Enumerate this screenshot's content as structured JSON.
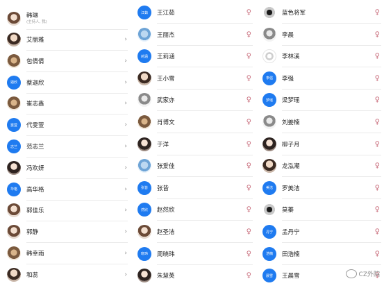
{
  "host": {
    "name": "韩琳",
    "role": "(主持人, 我)"
  },
  "columns": [
    [
      {
        "name": "艾丽雅",
        "avatar": "photo-a",
        "label": ""
      },
      {
        "name": "包倩倩",
        "avatar": "photo-c",
        "label": ""
      },
      {
        "name": "蔡迦欣",
        "avatar": "blue",
        "label": "迦欣"
      },
      {
        "name": "崔志鑫",
        "avatar": "photo-c",
        "label": ""
      },
      {
        "name": "代雯萱",
        "avatar": "blue",
        "label": "雯萱"
      },
      {
        "name": "范志兰",
        "avatar": "blue",
        "label": "志兰"
      },
      {
        "name": "冯欢妍",
        "avatar": "photo-e",
        "label": ""
      },
      {
        "name": "高华格",
        "avatar": "blue",
        "label": "华格"
      },
      {
        "name": "郭佳乐",
        "avatar": "photo-b",
        "label": ""
      },
      {
        "name": "郭静",
        "avatar": "photo-b",
        "label": ""
      },
      {
        "name": "韩幸雨",
        "avatar": "photo-c",
        "label": ""
      },
      {
        "name": "和蕊",
        "avatar": "photo-a",
        "label": ""
      }
    ],
    [
      {
        "name": "王江茹",
        "avatar": "blue",
        "label": "江茹"
      },
      {
        "name": "王丽杰",
        "avatar": "photo-f",
        "label": ""
      },
      {
        "name": "王莉涵",
        "avatar": "blue",
        "label": "莉涵"
      },
      {
        "name": "王小雪",
        "avatar": "photo-a",
        "label": ""
      },
      {
        "name": "武家亦",
        "avatar": "photo-d",
        "label": ""
      },
      {
        "name": "肖博文",
        "avatar": "photo-c",
        "label": ""
      },
      {
        "name": "于洋",
        "avatar": "photo-e",
        "label": ""
      },
      {
        "name": "张爱佳",
        "avatar": "photo-f",
        "label": ""
      },
      {
        "name": "张皆",
        "avatar": "blue",
        "label": "张皆"
      },
      {
        "name": "赵然欣",
        "avatar": "blue",
        "label": "然欣"
      },
      {
        "name": "赵圣洁",
        "avatar": "photo-b",
        "label": ""
      },
      {
        "name": "周晓玮",
        "avatar": "blue",
        "label": "晓玮"
      },
      {
        "name": "朱慧英",
        "avatar": "photo-e",
        "label": ""
      }
    ],
    [
      {
        "name": "蓝色将军",
        "avatar": "photo-h",
        "label": ""
      },
      {
        "name": "李晨",
        "avatar": "photo-d",
        "label": ""
      },
      {
        "name": "李林溪",
        "avatar": "photo-g",
        "label": ""
      },
      {
        "name": "李强",
        "avatar": "blue",
        "label": "李强"
      },
      {
        "name": "梁梦瑶",
        "avatar": "blue",
        "label": "梦瑶"
      },
      {
        "name": "刘姜楠",
        "avatar": "photo-d",
        "label": ""
      },
      {
        "name": "柳子月",
        "avatar": "photo-e",
        "label": ""
      },
      {
        "name": "龙泓潮",
        "avatar": "photo-a",
        "label": ""
      },
      {
        "name": "罗美洁",
        "avatar": "blue",
        "label": "美洁"
      },
      {
        "name": "莫蓁",
        "avatar": "photo-h",
        "label": ""
      },
      {
        "name": "孟丹宁",
        "avatar": "blue",
        "label": "丹宁"
      },
      {
        "name": "田浩楠",
        "avatar": "blue",
        "label": "浩楠"
      },
      {
        "name": "王晨雪",
        "avatar": "blue",
        "label": "晨雪"
      }
    ]
  ],
  "watermark": "CZ外院",
  "colors": {
    "accent": "#1f7bf0",
    "divider": "#ebebeb",
    "mark": "#c86b7a"
  }
}
